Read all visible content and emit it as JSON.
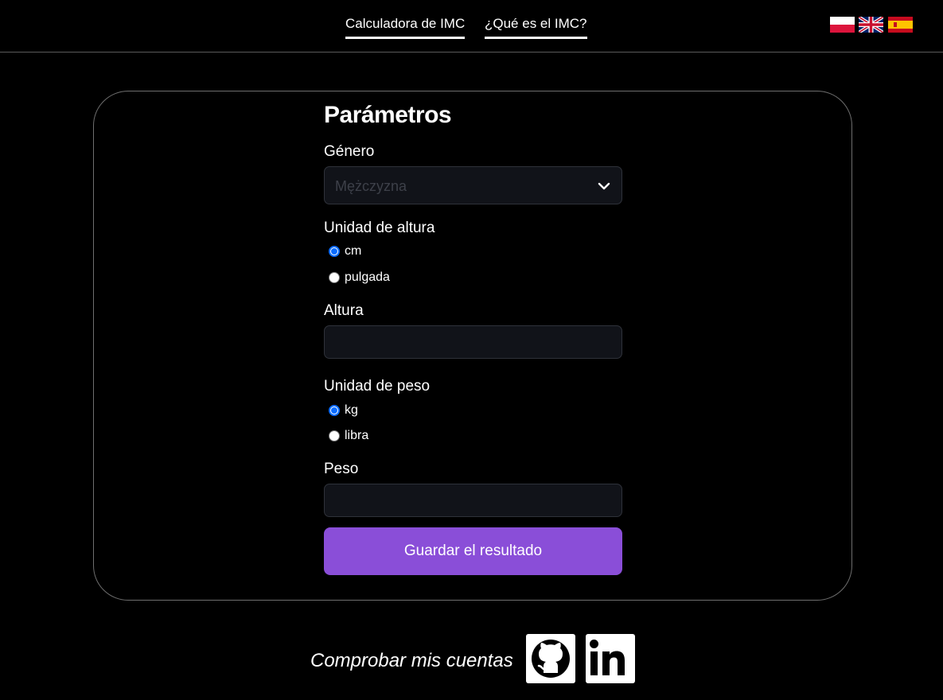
{
  "nav": {
    "calculator_label": "Calculadora de IMC",
    "what_is_label": "¿Qué es el IMC?"
  },
  "languages": [
    {
      "code": "pl",
      "icon": "poland-flag-icon"
    },
    {
      "code": "en",
      "icon": "uk-flag-icon"
    },
    {
      "code": "es",
      "icon": "spain-flag-icon"
    }
  ],
  "form": {
    "title": "Parámetros",
    "gender": {
      "label": "Género",
      "selected": "Mężczyzna"
    },
    "height_unit": {
      "label": "Unidad de altura",
      "options": [
        {
          "label": "cm",
          "checked": true
        },
        {
          "label": "pulgada",
          "checked": false
        }
      ]
    },
    "height": {
      "label": "Altura",
      "value": ""
    },
    "weight_unit": {
      "label": "Unidad de peso",
      "options": [
        {
          "label": "kg",
          "checked": true
        },
        {
          "label": "libra",
          "checked": false
        }
      ]
    },
    "weight": {
      "label": "Peso",
      "value": ""
    },
    "save_label": "Guardar el resultado"
  },
  "footer": {
    "text": "Comprobar mis cuentas",
    "links": [
      {
        "icon": "github-icon"
      },
      {
        "icon": "linkedin-icon"
      }
    ]
  },
  "colors": {
    "background": "#000000",
    "accent": "#8a4ed8",
    "input_bg": "#111319",
    "radio_checked": "#0a6cff"
  }
}
